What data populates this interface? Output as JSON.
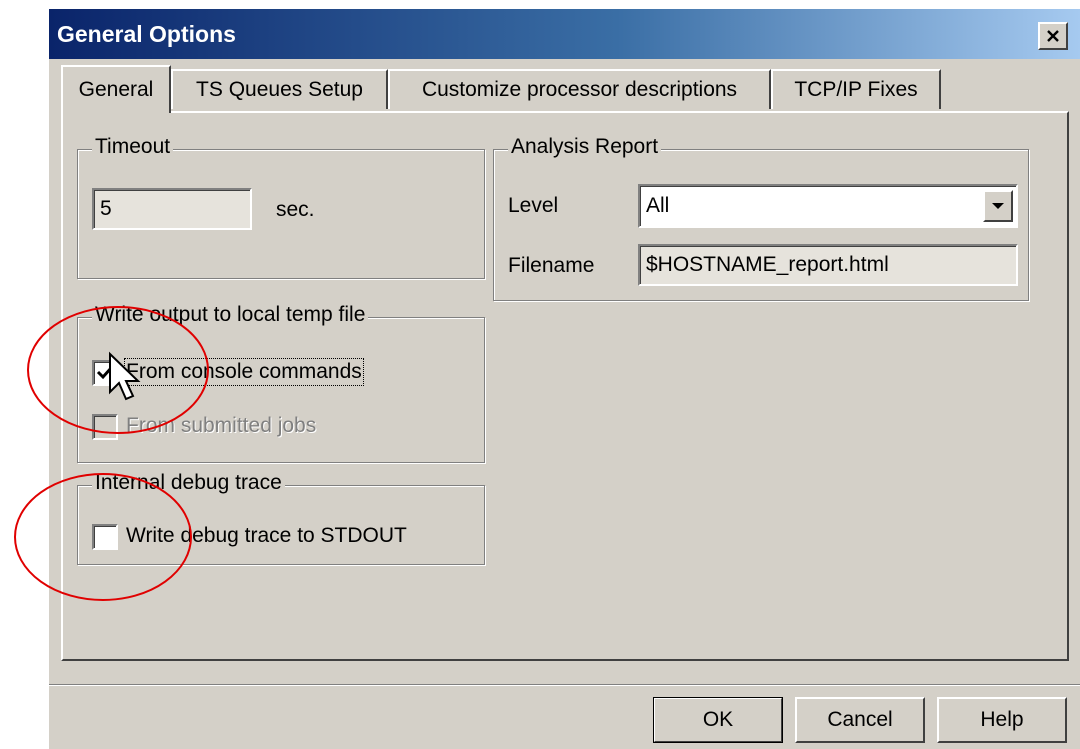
{
  "window": {
    "title": "General Options"
  },
  "icons": {
    "close": "close-icon",
    "dropdown": "chevron-down-icon",
    "check": "check-icon",
    "cursor": "mouse-pointer-icon"
  },
  "tabs": [
    {
      "label": "General",
      "active": true
    },
    {
      "label": "TS Queues Setup",
      "active": false
    },
    {
      "label": "Customize processor descriptions",
      "active": false
    },
    {
      "label": "TCP/IP Fixes",
      "active": false
    }
  ],
  "timeout": {
    "legend": "Timeout",
    "value": "5",
    "unit": "sec."
  },
  "analysis": {
    "legend": "Analysis Report",
    "level_label": "Level",
    "level_value": "All",
    "filename_label": "Filename",
    "filename_value": "$HOSTNAME_report.html"
  },
  "output": {
    "legend": "Write output to local temp file",
    "console_label": "From console commands",
    "console_checked": true,
    "submitted_label": "From submitted jobs",
    "submitted_checked": false,
    "submitted_enabled": false
  },
  "debug": {
    "legend": "Internal debug trace",
    "stdout_label": "Write debug trace to STDOUT",
    "stdout_checked": false
  },
  "buttons": {
    "ok": "OK",
    "cancel": "Cancel",
    "help": "Help"
  },
  "colors": {
    "title_start": "#0a246a",
    "title_end": "#a6caf0",
    "face": "#d4d0c8",
    "annotation": "#e00000"
  }
}
